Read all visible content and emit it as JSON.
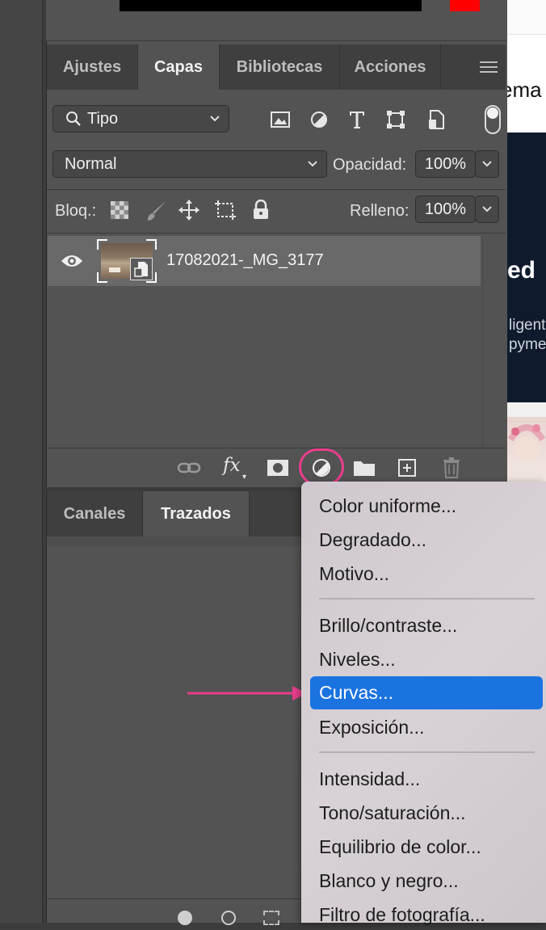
{
  "layers_panel": {
    "tabs": [
      {
        "label": "Ajustes"
      },
      {
        "label": "Capas"
      },
      {
        "label": "Bibliotecas"
      },
      {
        "label": "Acciones"
      }
    ],
    "filter": {
      "label": "Tipo"
    },
    "blend_mode": {
      "label": "Normal"
    },
    "opacity": {
      "label": "Opacidad:",
      "value": "100%"
    },
    "lock": {
      "label": "Bloq.:"
    },
    "fill": {
      "label": "Relleno:",
      "value": "100%"
    },
    "layers": [
      {
        "name": "17082021-_MG_3177"
      }
    ],
    "bottom_tools": {
      "fx": "fx"
    }
  },
  "paths_panel": {
    "tabs": [
      {
        "label": "Canales"
      },
      {
        "label": "Trazados"
      }
    ]
  },
  "adjustment_menu": {
    "groups": [
      [
        "Color uniforme...",
        "Degradado...",
        "Motivo..."
      ],
      [
        "Brillo/contraste...",
        "Niveles...",
        "Curvas...",
        "Exposición..."
      ],
      [
        "Intensidad...",
        "Tono/saturación...",
        "Equilibrio de color...",
        "Blanco y negro...",
        "Filtro de fotografía..."
      ]
    ],
    "selected": "Curvas..."
  },
  "background_web": {
    "snippets": [
      "ema",
      "ed",
      "ligent",
      "pyme"
    ]
  },
  "colors": {
    "annotation": "#e83e8c",
    "menu_highlight": "#1b73e0"
  }
}
